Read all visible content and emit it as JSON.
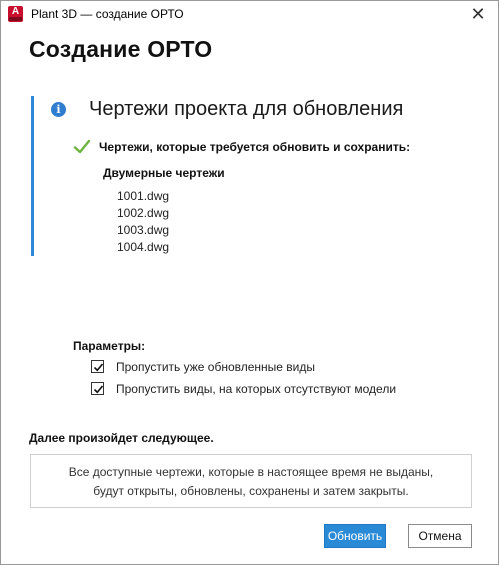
{
  "window": {
    "title": "Plant 3D — создание ОРТО",
    "app_icon_letter": "A",
    "close_glyph": "✕"
  },
  "page": {
    "title": "Создание ОРТО"
  },
  "info": {
    "icon": "info-icon",
    "icon_glyph": "i",
    "heading": "Чертежи проекта для обновления",
    "check_icon": "checkmark-icon",
    "check_text": "Чертежи, которые требуется обновить и сохранить:",
    "section_title": "Двумерные чертежи",
    "files": [
      "1001.dwg",
      "1002.dwg",
      "1003.dwg",
      "1004.dwg"
    ]
  },
  "params": {
    "label": "Параметры:",
    "options": [
      {
        "label": "Пропустить уже обновленные виды",
        "checked": true
      },
      {
        "label": "Пропустить виды, на которых отсутствуют модели",
        "checked": true
      }
    ]
  },
  "next": {
    "label": "Далее произойдет следующее.",
    "line1": "Все доступные чертежи, которые в настоящее время не выданы,",
    "line2": "будут открыты, обновлены, сохранены и затем закрыты."
  },
  "buttons": {
    "update": "Обновить",
    "cancel": "Отмена"
  },
  "colors": {
    "accent": "#2e8ad8",
    "primary_button": "#2a8ad6",
    "check_green": "#6db33f",
    "brand_red": "#c8102e"
  }
}
